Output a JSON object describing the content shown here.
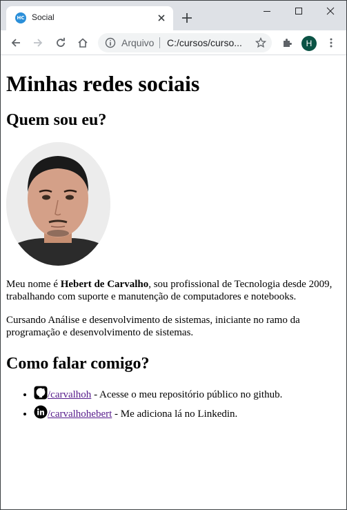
{
  "browser": {
    "tab_title": "Social",
    "favicon_text": "HC",
    "omnibox_label": "Arquivo",
    "url": "C:/cursos/curso...",
    "profile_initial": "H"
  },
  "page": {
    "title": "Minhas redes sociais",
    "who_heading": "Quem sou eu?",
    "bio_prefix": "Meu nome é ",
    "bio_name": "Hebert de Carvalho",
    "bio_suffix": ", sou profissional de Tecnologia desde 2009, trabalhando com suporte e manutenção de computadores e notebooks.",
    "study_text": "Cursando Análise e desenvolvimento de sistemas, iniciante no ramo da programação e desenvolvimento de sistemas.",
    "contact_heading": "Como falar comigo?",
    "links": [
      {
        "icon": "github-icon",
        "text": "/carvalhoh",
        "desc": " - Acesse o meu repositório público no github."
      },
      {
        "icon": "linkedin-icon",
        "text": "/carvalhohebert",
        "desc": " - Me adiciona lá no Linkedin."
      }
    ]
  },
  "colors": {
    "tabstrip": "#dee1e6",
    "link": "#551a8b",
    "avatar": "#0b5345"
  }
}
